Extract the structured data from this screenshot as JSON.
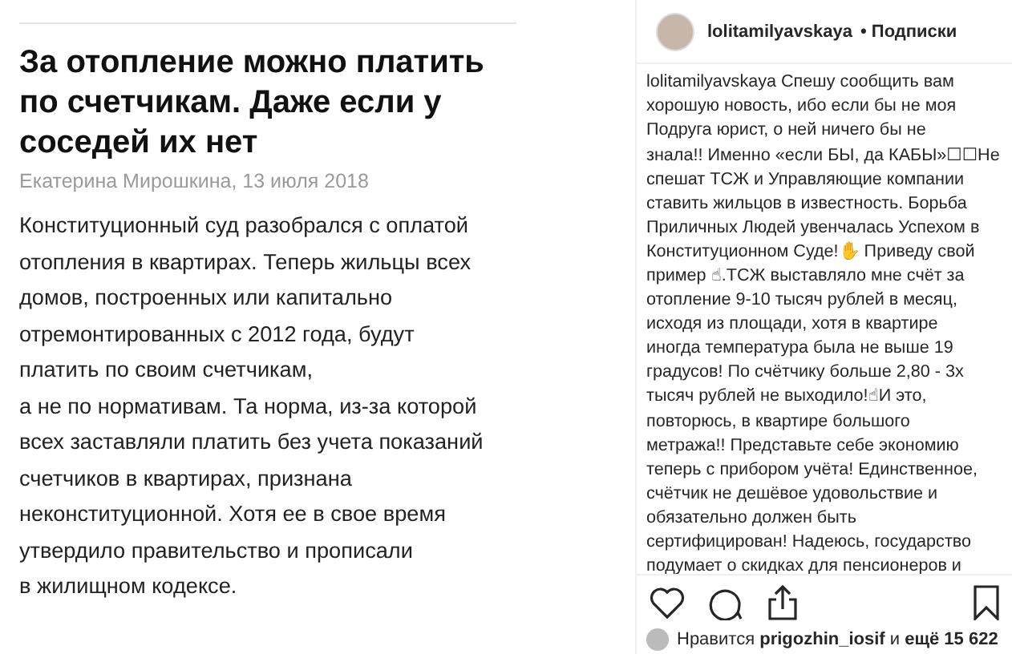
{
  "article": {
    "title": "За отопление можно платить по счетчикам. Даже если у соседей их нет",
    "byline": "Екатерина Мирошкина, 13 июля 2018",
    "body": "Конституционный суд разобрался с оплатой\nотопления в квартирах. Теперь жильцы всех\nдомов, построенных или капитально\nотремонтированных с 2012 года, будут\nплатить по своим счетчикам,\nа не по нормативам. Та норма, из-за которой\nвсех заставляли платить без учета показаний\nсчетчиков в квартирах, признана\nнеконституционной. Хотя ее в свое время\nутвердило правительство и прописали\nв жилищном кодексе."
  },
  "post": {
    "username": "lolitamilyavskaya",
    "follow": "• Подписки",
    "caption_lines": [
      "lolitamilyavskaya Спешу сообщить вам",
      "хорошую новость, ибо если бы не моя",
      "Подруга юрист, о ней ничего бы не",
      "знала!! Именно «если БЫ, да КАБЫ»☐☐Не",
      "спешат ТСЖ и Управляющие компании",
      "ставить жильцов в известность. Борьба",
      "Приличных Людей увенчалась Успехом в",
      "Конституционном Суде!✋ Приведу свой",
      "пример ☝.ТСЖ выставляло мне счёт за",
      "отопление 9-10 тысяч рублей в месяц,",
      "исходя из площади, хотя в квартире",
      "иногда температура была не выше 19",
      "градусов! По счётчику больше 2,80 - 3х",
      "тысяч рублей не выходило!☝И это,",
      "повторюсь, в квартире большого",
      "метража!! Представьте себе экономию",
      "теперь с прибором учёта! Единственное,",
      "счётчик не дешёвое удовольствие и",
      "обязательно должен быть",
      "сертифицирован! Надеюсь, государство",
      "подумает о скидках для пенсионеров и"
    ],
    "likes": "Нравится **prigozhin_iosif** и **ещё 15 622**"
  }
}
